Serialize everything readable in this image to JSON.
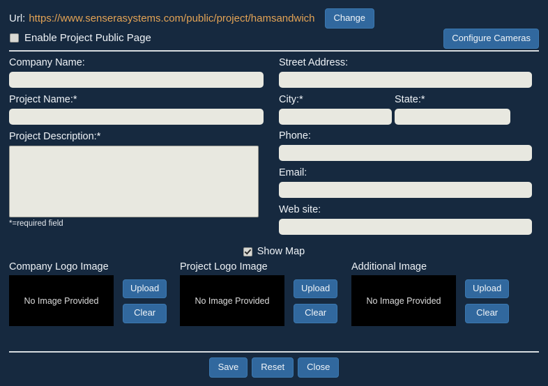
{
  "header": {
    "url_label": "Url:",
    "url_value": "https://www.senserasystems.com/public/project/hamsandwich",
    "change_label": "Change",
    "enable_public_page_label": "Enable Project Public Page",
    "enable_public_page_checked": false,
    "configure_cameras_label": "Configure Cameras"
  },
  "form": {
    "company_name_label": "Company Name:",
    "company_name_value": "",
    "project_name_label": "Project Name:*",
    "project_name_value": "",
    "project_description_label": "Project Description:*",
    "project_description_value": "",
    "required_note": "*=required field",
    "street_address_label": "Street Address:",
    "street_address_value": "",
    "city_label": "City:*",
    "city_value": "",
    "state_label": "State:*",
    "state_value": "",
    "phone_label": "Phone:",
    "phone_value": "",
    "email_label": "Email:",
    "email_value": "",
    "website_label": "Web site:",
    "website_value": ""
  },
  "show_map": {
    "label": "Show Map",
    "checked": true
  },
  "images": {
    "upload_label": "Upload",
    "clear_label": "Clear",
    "placeholder_text": "No Image Provided",
    "sections": [
      {
        "title": "Company Logo Image"
      },
      {
        "title": "Project Logo Image"
      },
      {
        "title": "Additional Image"
      }
    ]
  },
  "footer": {
    "save_label": "Save",
    "reset_label": "Reset",
    "close_label": "Close"
  },
  "colors": {
    "background": "#16293f",
    "button": "#31689e",
    "url_link": "#e3a355",
    "input_background": "#e8e8e0",
    "image_box": "#000000",
    "divider": "#d7dce0"
  }
}
